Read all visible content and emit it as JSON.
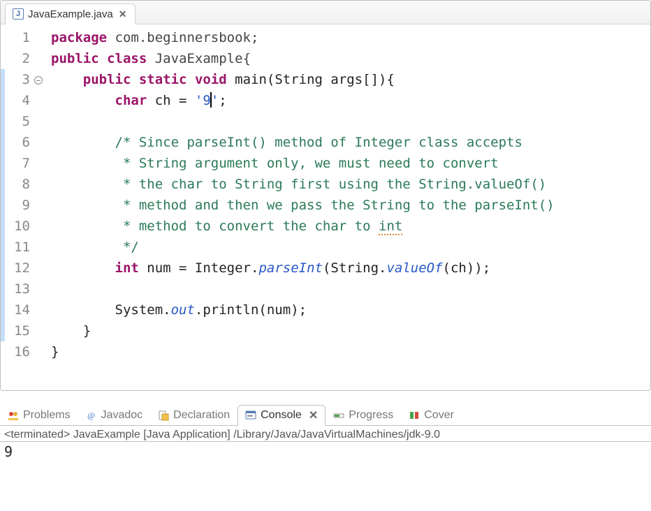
{
  "editor": {
    "tab": {
      "title": "JavaExample.java"
    },
    "lineNumbers": [
      "1",
      "2",
      "3",
      "4",
      "5",
      "6",
      "7",
      "8",
      "9",
      "10",
      "11",
      "12",
      "13",
      "14",
      "15",
      "16"
    ],
    "foldableLine": 3,
    "highlightedLine": 4,
    "blueMarks": [
      3,
      4,
      5,
      6,
      7,
      8,
      9,
      10,
      11,
      12,
      13,
      14,
      15
    ],
    "code": {
      "l1": {
        "kw": "package",
        "rest": " com.beginnersbook;"
      },
      "l2": {
        "kw1": "public",
        "kw2": "class",
        "name": " JavaExample{"
      },
      "l3": {
        "indent": "    ",
        "kw1": "public",
        "kw2": "static",
        "kw3": "void",
        "sig": " main(String args[]){"
      },
      "l4": {
        "indent": "        ",
        "kw": "char",
        "decl": " ch = ",
        "lit": "'9'",
        "tail": ";"
      },
      "l5": "",
      "l6": "        /* Since parseInt() method of Integer class accepts",
      "l7": "         * String argument only, we must need to convert",
      "l8": "         * the char to String first using the String.valueOf()",
      "l9": "         * method and then we pass the String to the parseInt()",
      "l10a": "         * method to convert the char to ",
      "l10b": "int",
      "l11": "         */",
      "l12": {
        "indent": "        ",
        "kw": "int",
        "pre": " num = Integer.",
        "m1": "parseInt",
        "mid": "(String.",
        "m2": "valueOf",
        "tail": "(ch));"
      },
      "l13": "",
      "l14": {
        "indent": "        ",
        "pre": "System.",
        "out": "out",
        "tail": ".println(num);"
      },
      "l15": "    }",
      "l16": "}"
    }
  },
  "views": {
    "problems": "Problems",
    "javadoc": "Javadoc",
    "declaration": "Declaration",
    "console": "Console",
    "progress": "Progress",
    "coverage": "Cover"
  },
  "console": {
    "status": "<terminated> JavaExample [Java Application] /Library/Java/JavaVirtualMachines/jdk-9.0",
    "output": "9"
  }
}
